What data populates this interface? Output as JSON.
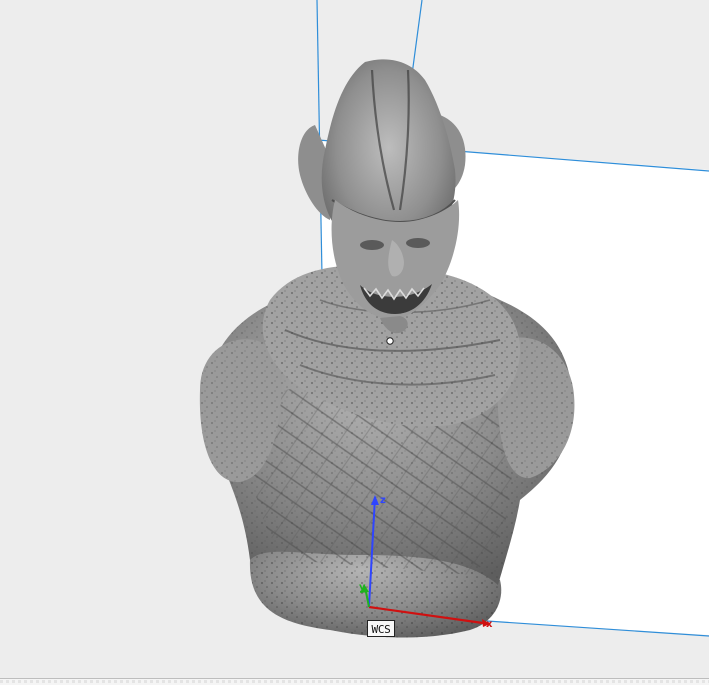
{
  "viewport": {
    "background": "#ededed",
    "plane_color": "#ffffff",
    "grid_line_color": "#2f8ed9"
  },
  "model": {
    "name": "goblin-bust",
    "color": "#8a8a8a"
  },
  "wcs": {
    "label": "WCS",
    "x_label": "x",
    "y_label": "y",
    "z_label": "z",
    "x_color": "#d01010",
    "y_color": "#1fb21f",
    "z_color": "#2f45ff"
  }
}
